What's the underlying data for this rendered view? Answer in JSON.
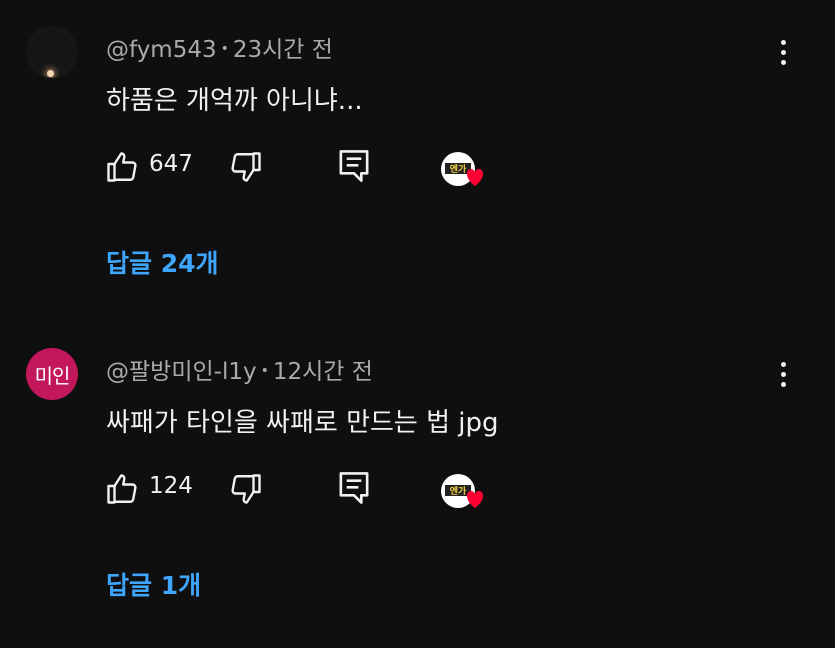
{
  "comments": [
    {
      "author": "@fym543",
      "time": "23시간 전",
      "text": "하품은 개억까 아니냐...",
      "likes": "647",
      "replies_label": "답글 24개",
      "avatar_text": ""
    },
    {
      "author": "@팔방미인-l1y",
      "time": "12시간 전",
      "text": "싸패가 타인을 싸패로 만드는 법 jpg",
      "likes": "124",
      "replies_label": "답글 1개",
      "avatar_text": "미인"
    }
  ],
  "separator": "•",
  "badge_text": "엔가",
  "colors": {
    "background": "#0f0f0f",
    "link": "#3ea6ff",
    "avatar2": "#c2185b",
    "heart": "#ff0033"
  },
  "icons": [
    "like-icon",
    "dislike-icon",
    "reply-icon",
    "more-vert-icon",
    "creator-heart-icon"
  ]
}
